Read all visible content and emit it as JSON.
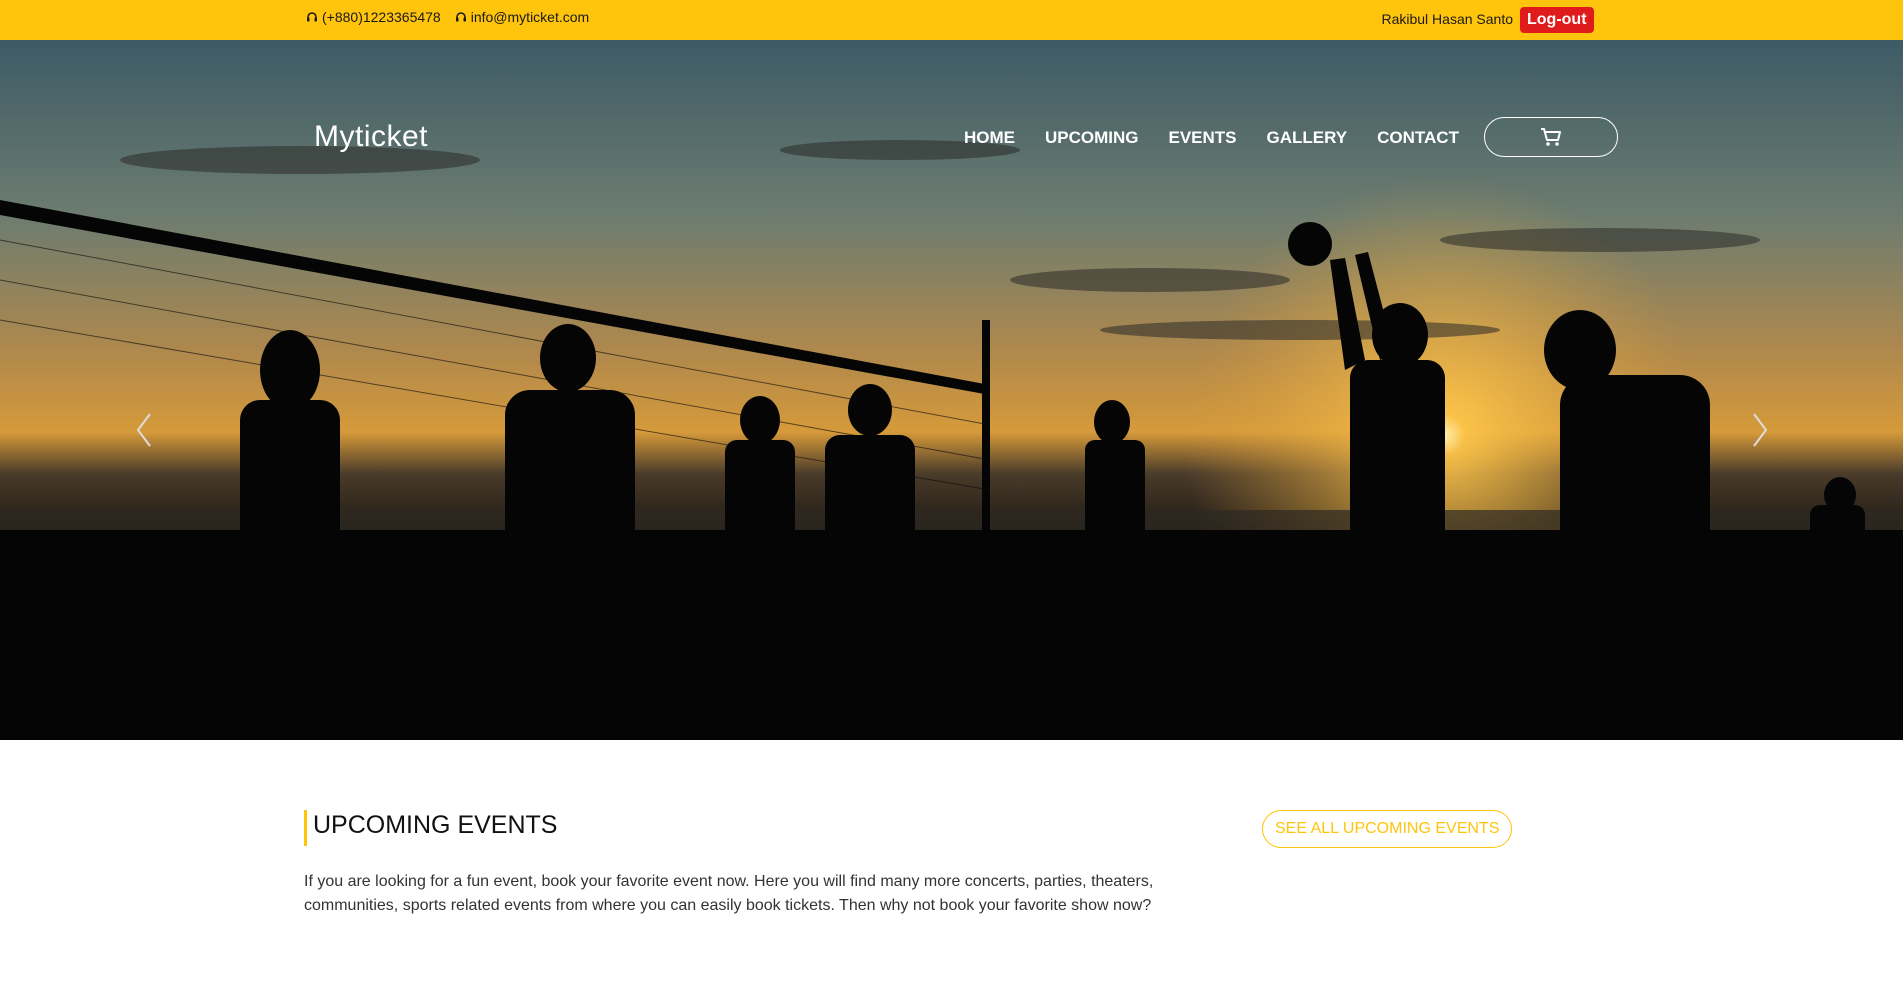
{
  "topbar": {
    "phone": "(+880)1223365478",
    "email": "info@myticket.com",
    "user_name": "Rakibul Hasan Santo",
    "logout_label": "Log-out"
  },
  "header": {
    "brand": "Myticket",
    "nav": [
      {
        "label": "HOME"
      },
      {
        "label": "UPCOMING"
      },
      {
        "label": "EVENTS"
      },
      {
        "label": "GALLERY"
      },
      {
        "label": "CONTACT"
      }
    ],
    "cart_icon": "cart-icon"
  },
  "hero": {
    "prev_icon": "chevron-left-icon",
    "next_icon": "chevron-right-icon"
  },
  "upcoming": {
    "title": "UPCOMING EVENTS",
    "see_all_label": "SEE ALL UPCOMING EVENTS",
    "description": "If you are looking for a fun event, book your favorite event now. Here you will find many more concerts, parties, theaters, communities, sports related events from where you can easily book tickets. Then why not book your favorite show now?"
  },
  "colors": {
    "accent": "#FFC40C",
    "logout": "#E01B1B"
  }
}
